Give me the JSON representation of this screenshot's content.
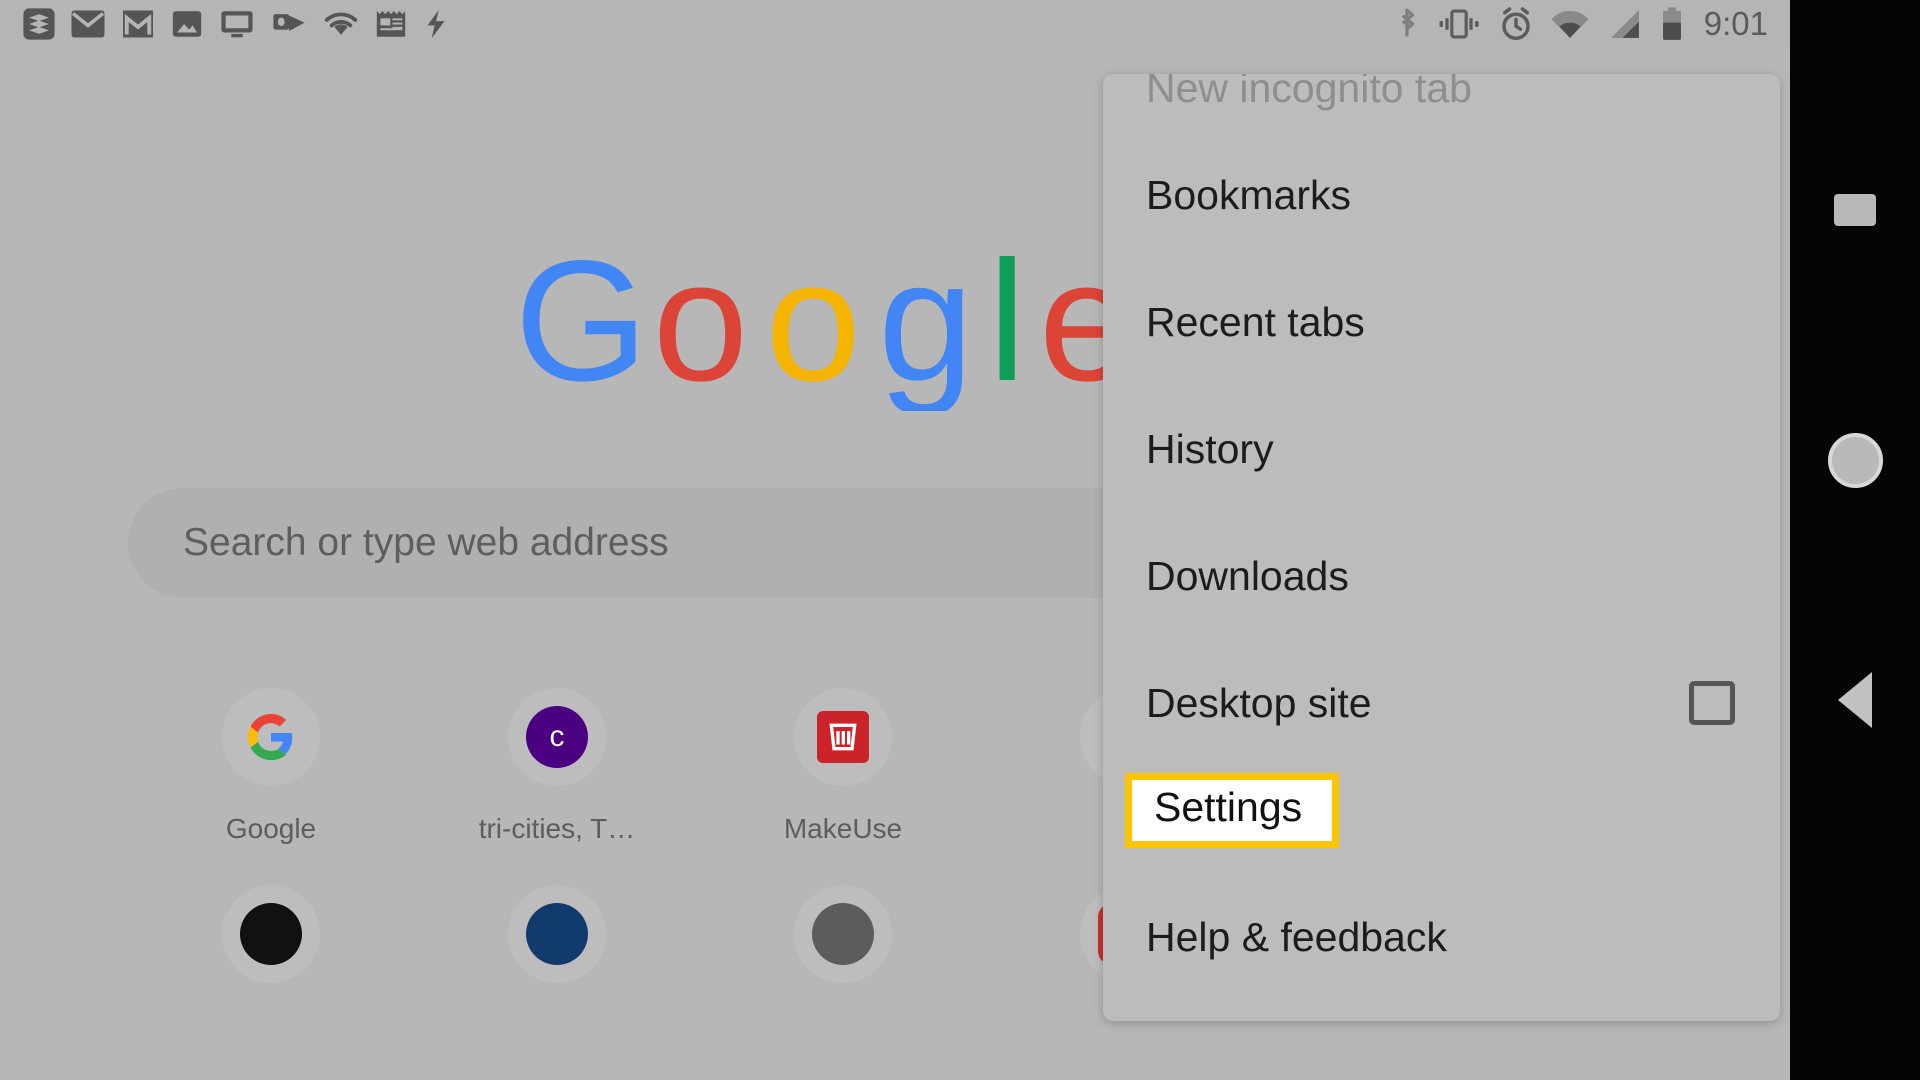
{
  "statusbar": {
    "clock": "9:01",
    "left_icons": [
      {
        "name": "todoist-icon"
      },
      {
        "name": "email-icon"
      },
      {
        "name": "gmail-icon"
      },
      {
        "name": "photos-icon"
      },
      {
        "name": "cast-screen-icon"
      },
      {
        "name": "outlook-icon"
      },
      {
        "name": "wifi-notification-icon"
      },
      {
        "name": "calendar-icon"
      },
      {
        "name": "flash-icon"
      }
    ],
    "right_icons": [
      {
        "name": "bluetooth-icon"
      },
      {
        "name": "vibrate-icon"
      },
      {
        "name": "alarm-icon"
      },
      {
        "name": "wifi-icon"
      },
      {
        "name": "cell-signal-icon"
      },
      {
        "name": "battery-icon"
      }
    ]
  },
  "ntp": {
    "logo_alt": "Google",
    "omnibox_placeholder": "Search or type web address",
    "tiles_row1": [
      {
        "label": "Google",
        "icon": "google-g-icon",
        "color": "#ffffff",
        "letter": ""
      },
      {
        "label": "tri-cities, T…",
        "icon": "letter-avatar",
        "color": "#4b0082",
        "letter": "c"
      },
      {
        "label": "MakeUse",
        "icon": "makeuseof-icon",
        "color": "#cc2229",
        "letter": ""
      },
      {
        "label": "",
        "icon": "none",
        "color": "",
        "letter": ""
      }
    ],
    "tiles_row2": [
      {
        "label": "",
        "icon": "letter-avatar",
        "color": "#111111",
        "letter": ""
      },
      {
        "label": "",
        "icon": "letter-avatar",
        "color": "#123b6d",
        "letter": ""
      },
      {
        "label": "",
        "icon": "letter-avatar",
        "color": "#5c5c5c",
        "letter": ""
      },
      {
        "label": "",
        "icon": "youtube-icon",
        "color": "#c4302b",
        "letter": ""
      }
    ]
  },
  "menu": {
    "items": [
      {
        "label": "New incognito tab",
        "clipped": true,
        "checkbox": false,
        "highlighted": false
      },
      {
        "label": "Bookmarks",
        "clipped": false,
        "checkbox": false,
        "highlighted": false
      },
      {
        "label": "Recent tabs",
        "clipped": false,
        "checkbox": false,
        "highlighted": false
      },
      {
        "label": "History",
        "clipped": false,
        "checkbox": false,
        "highlighted": false
      },
      {
        "label": "Downloads",
        "clipped": false,
        "checkbox": false,
        "highlighted": false
      },
      {
        "label": "Desktop site",
        "clipped": false,
        "checkbox": true,
        "highlighted": false
      },
      {
        "label": "Settings",
        "clipped": false,
        "checkbox": false,
        "highlighted": true
      },
      {
        "label": "Help & feedback",
        "clipped": false,
        "checkbox": false,
        "highlighted": false
      }
    ],
    "highlight_color": "#fdc500",
    "panel_color": "#bcbcbc"
  },
  "navbar": {
    "recents_label": "Recents",
    "home_label": "Home",
    "back_label": "Back"
  }
}
